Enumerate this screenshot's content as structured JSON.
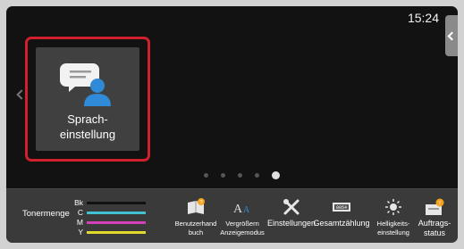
{
  "status": {
    "clock": "15:24"
  },
  "home": {
    "tile": {
      "label": "Sprach-\neinstellung",
      "icon": "speech-bubble-person-icon"
    },
    "page_count": 5,
    "active_page": 5
  },
  "toner": {
    "label": "Tonermenge",
    "levels": [
      {
        "letter": "Bk",
        "color": "#111111",
        "level": 1.0
      },
      {
        "letter": "C",
        "color": "#3fc3d0",
        "level": 1.0
      },
      {
        "letter": "M",
        "color": "#d53fb8",
        "level": 1.0
      },
      {
        "letter": "Y",
        "color": "#e2da2a",
        "level": 1.0
      }
    ]
  },
  "shortcuts": [
    {
      "label": "Benutzerhand\nbuch",
      "icon": "manual-icon"
    },
    {
      "label": "Vergrößern\nAnzeigemodus",
      "icon": "font-size-icon"
    },
    {
      "label": "Einstellungen",
      "icon": "wrench-screwdriver-icon"
    },
    {
      "label": "Gesamtzählung",
      "icon": "counter-icon"
    },
    {
      "label": "Helligkeits-\neinstellung",
      "icon": "brightness-icon"
    },
    {
      "label": "Auftrags-\nstatus",
      "icon": "job-status-icon"
    }
  ],
  "colors": {
    "accent_red": "#d0202e",
    "badge_orange": "#f5a21d",
    "icon_blue": "#2f8ad7"
  }
}
